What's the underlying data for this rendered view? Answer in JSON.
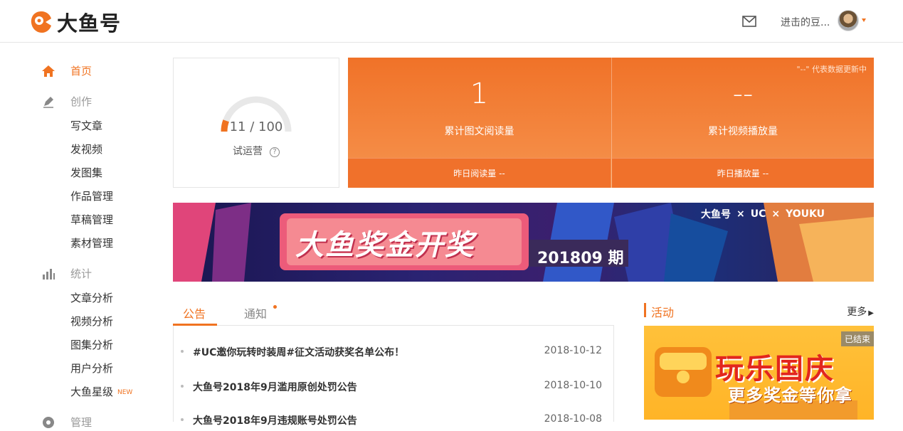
{
  "header": {
    "brand": "大鱼号",
    "username": "进击的豆...",
    "icons": {
      "mail": "mail-icon",
      "avatar": "user-avatar"
    }
  },
  "sidebar": {
    "sections": [
      {
        "label": "首页",
        "icon": "home-icon",
        "active": true,
        "items": []
      },
      {
        "label": "创作",
        "icon": "pen-icon",
        "items": [
          "写文章",
          "发视频",
          "发图集",
          "作品管理",
          "草稿管理",
          "素材管理"
        ]
      },
      {
        "label": "统计",
        "icon": "bar-chart-icon",
        "items": [
          "文章分析",
          "视频分析",
          "图集分析",
          "用户分析",
          "大鱼星级"
        ]
      },
      {
        "label": "管理",
        "icon": "settings-icon",
        "items": []
      }
    ],
    "new_badge": "NEW"
  },
  "progress": {
    "current": 11,
    "total": 100,
    "display": "11 / 100",
    "label": "试运营",
    "help": "?"
  },
  "stats": {
    "note": "\"--\" 代表数据更新中",
    "items": [
      {
        "value": "1",
        "label": "累计图文阅读量",
        "sub": "昨日阅读量 --"
      },
      {
        "value": "--",
        "label": "累计视频播放量",
        "sub": "昨日播放量 --"
      }
    ],
    "colors": {
      "accent": "#f07321"
    }
  },
  "banner": {
    "title": "大鱼奖金开奖",
    "period": "201809 期",
    "brands": [
      "大鱼号",
      "UC",
      "YOUKU"
    ],
    "sep": "×"
  },
  "tabs": [
    "公告",
    "通知"
  ],
  "notices": [
    {
      "title": "#UC邀你玩转时装周#征文活动获奖名单公布！",
      "date": "2018-10-12"
    },
    {
      "title": "大鱼号2018年9月滥用原创处罚公告",
      "date": "2018-10-10"
    },
    {
      "title": "大鱼号2018年9月违规账号处罚公告",
      "date": "2018-10-08"
    }
  ],
  "activity": {
    "title": "活动",
    "more": "更多",
    "card": {
      "badge": "已结束",
      "line1": "玩乐国庆",
      "line2": "更多奖金等你拿"
    }
  }
}
